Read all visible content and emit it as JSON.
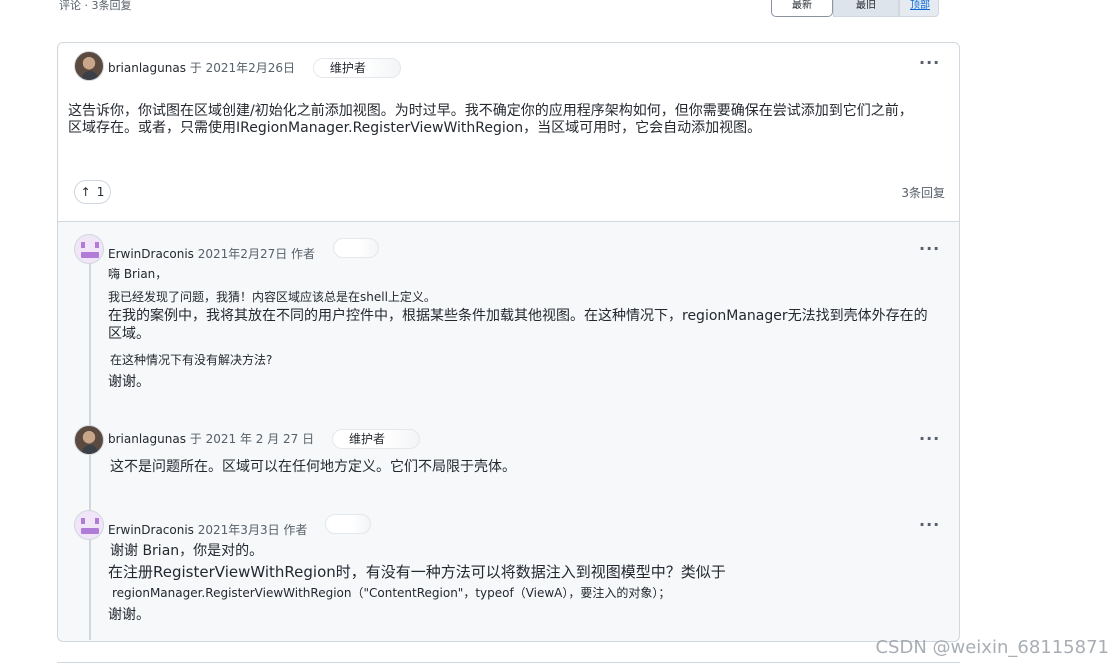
{
  "top": {
    "comments_meta": "评论 · 3条回复",
    "sort_latest": "最新",
    "sort_mid": "最旧",
    "sort_top": "顶部"
  },
  "main_comment": {
    "author": "brianlagunas",
    "date_text": "于 2021年2月26日",
    "badge": "维护者",
    "lines": [
      "这告诉你，你试图在区域创建/初始化之前添加视图。为时过早。我不确定你的应用程序架构如何，但你需要确保在尝试添加到它们之前，",
      "区域存在。或者，只需使用IRegionManager.RegisterViewWithRegion，当区域可用时，它会自动添加视图。"
    ],
    "upvote_icon": "arrow-up-icon",
    "upvotes": "1",
    "reply_count": "3条回复",
    "menu": "···"
  },
  "replies": [
    {
      "author": "ErwinDraconis",
      "date_text": "2021年2月27日 作者",
      "lines": [
        "嗨 Brian，",
        "我已经发现了问题，我猜！内容区域应该总是在shell上定义。",
        "在我的案例中，我将其放在不同的用户控件中，根据某些条件加载其他视图。在这种情况下，regionManager无法找到壳体外存在的",
        "区域。",
        "在这种情况下有没有解决方法?",
        "谢谢。"
      ],
      "menu": "···"
    },
    {
      "author": "brianlagunas",
      "date_text": "于 2021 年 2 月 27 日",
      "badge": "维护者",
      "lines": [
        "这不是问题所在。区域可以在任何地方定义。它们不局限于壳体。"
      ],
      "menu": "···"
    },
    {
      "author": "ErwinDraconis",
      "date_text": "2021年3月3日 作者",
      "lines": [
        "谢谢 Brian，你是对的。",
        "在注册RegisterViewWithRegion时，有没有一种方法可以将数据注入到视图模型中？类似于",
        "regionManager.RegisterViewWithRegion（\"ContentRegion\"，typeof（ViewA），要注入的对象）；",
        "谢谢。"
      ],
      "menu": "···"
    }
  ],
  "watermark": "CSDN @weixin_68115871"
}
